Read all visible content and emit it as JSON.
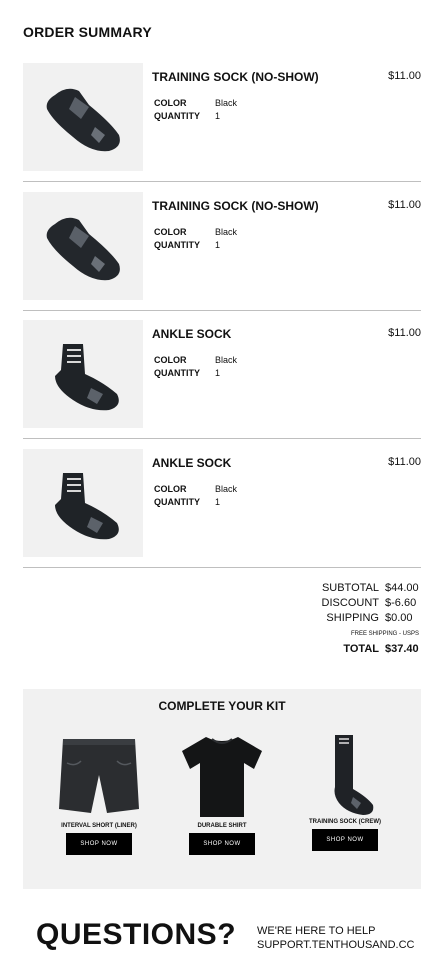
{
  "order": {
    "title": "ORDER SUMMARY",
    "color_label": "COLOR",
    "quantity_label": "QUANTITY",
    "items": [
      {
        "name": "TRAINING SOCK (NO-SHOW)",
        "price": "$11.00",
        "color": "Black",
        "quantity": "1",
        "image": "no-show-sock-icon"
      },
      {
        "name": "TRAINING SOCK (NO-SHOW)",
        "price": "$11.00",
        "color": "Black",
        "quantity": "1",
        "image": "no-show-sock-icon"
      },
      {
        "name": "ANKLE SOCK",
        "price": "$11.00",
        "color": "Black",
        "quantity": "1",
        "image": "ankle-sock-icon"
      },
      {
        "name": "ANKLE SOCK",
        "price": "$11.00",
        "color": "Black",
        "quantity": "1",
        "image": "ankle-sock-icon"
      }
    ]
  },
  "totals": {
    "subtotal_label": "SUBTOTAL",
    "subtotal": "$44.00",
    "discount_label": "DISCOUNT",
    "discount": "$-6.60",
    "shipping_label": "SHIPPING",
    "shipping": "$0.00",
    "shipping_note": "FREE SHIPPING - USPS",
    "total_label": "TOTAL",
    "total": "$37.40"
  },
  "kit": {
    "title": "COMPLETE YOUR KIT",
    "items": [
      {
        "name": "INTERVAL SHORT (LINER)",
        "button": "SHOP NOW",
        "image": "shorts-icon"
      },
      {
        "name": "DURABLE SHIRT",
        "button": "SHOP NOW",
        "image": "shirt-icon"
      },
      {
        "name": "TRAINING SOCK (CREW)",
        "button": "SHOP NOW",
        "image": "crew-sock-icon"
      }
    ]
  },
  "footer": {
    "questions": "QUESTIONS?",
    "help_line1": "WE'RE HERE TO HELP",
    "help_line2": "SUPPORT.TENTHOUSAND.CC"
  },
  "colors": {
    "text": "#111111",
    "panel": "#f1f1f1",
    "button": "#000000",
    "divider": "#bfbfbf"
  }
}
